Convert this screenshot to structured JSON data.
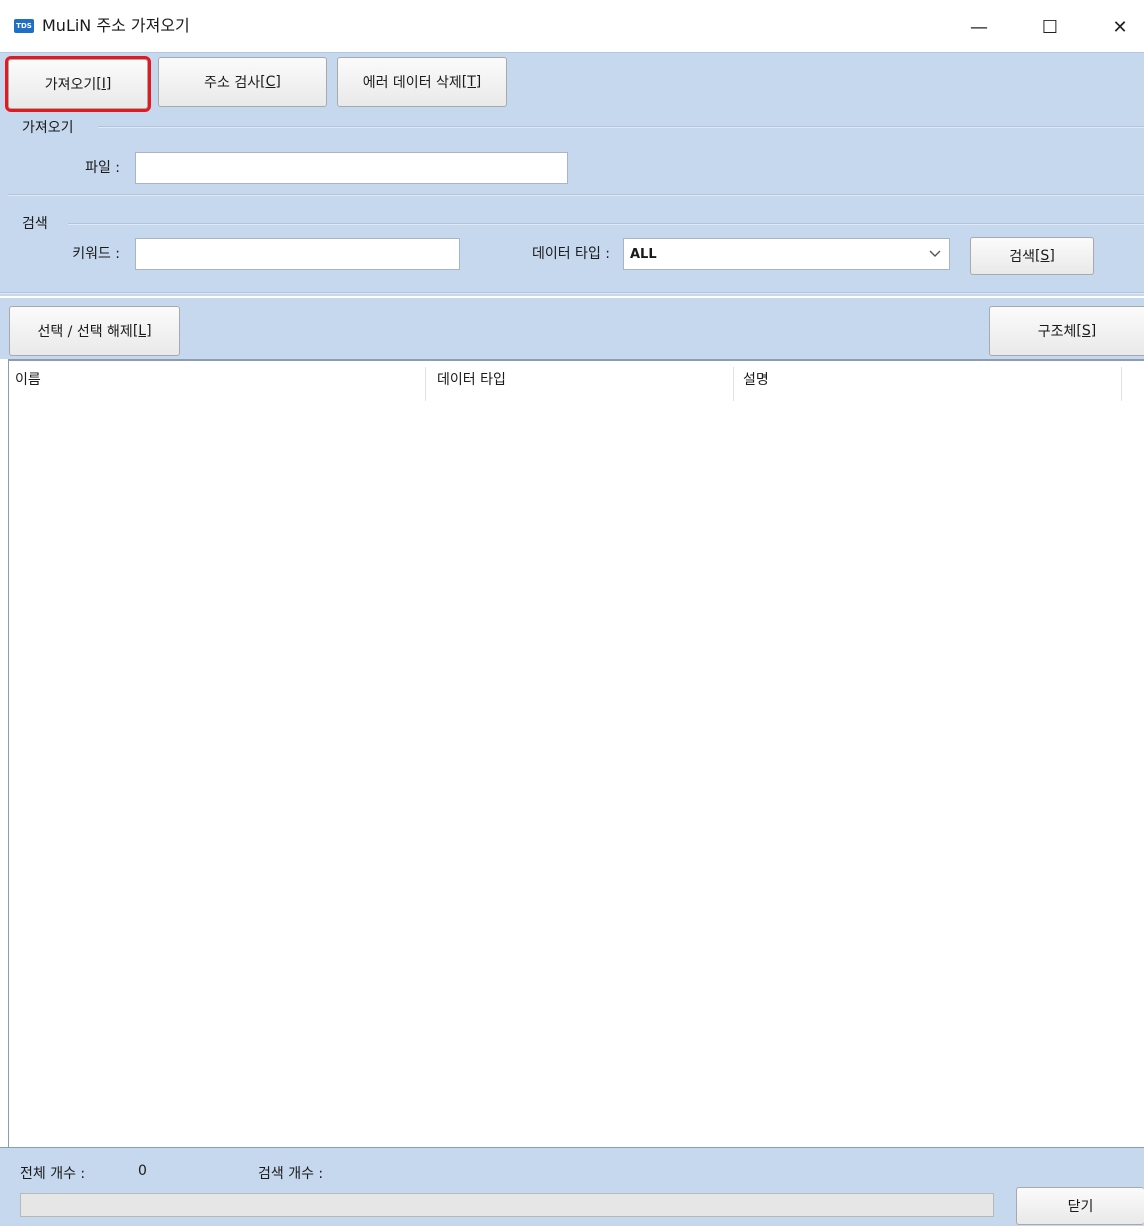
{
  "window": {
    "app_icon_text": "TDS",
    "title": "MuLiN 주소 가져오기",
    "minimize": "—",
    "maximize": "☐",
    "close": "✕"
  },
  "toolbar": {
    "import_label": "가져오기",
    "import_key": "[I]",
    "check_label": "주소 검사",
    "check_key": "[C]",
    "delete_label": "에러 데이터 삭제",
    "delete_key": "[T]"
  },
  "import_group": {
    "title": "가져오기",
    "file_label": "파일 :",
    "file_value": ""
  },
  "search_group": {
    "title": "검색",
    "keyword_label": "키워드 :",
    "keyword_value": "",
    "datatype_label": "데이터 타입 :",
    "datatype_value": "ALL",
    "search_label": "검색",
    "search_key": "[S]"
  },
  "list_toolbar": {
    "toggle_label": "선택 / 선택 해제",
    "toggle_key": "[L]",
    "struct_label": "구조체",
    "struct_key": "[S]"
  },
  "table": {
    "columns": [
      "이름",
      "데이터 타입",
      "설명"
    ],
    "rows": []
  },
  "status": {
    "total_label": "전체 개수 :",
    "total_value": "0",
    "search_count_label": "검색 개수 :",
    "search_count_value": "",
    "progress": 0,
    "close_label": "닫기"
  }
}
